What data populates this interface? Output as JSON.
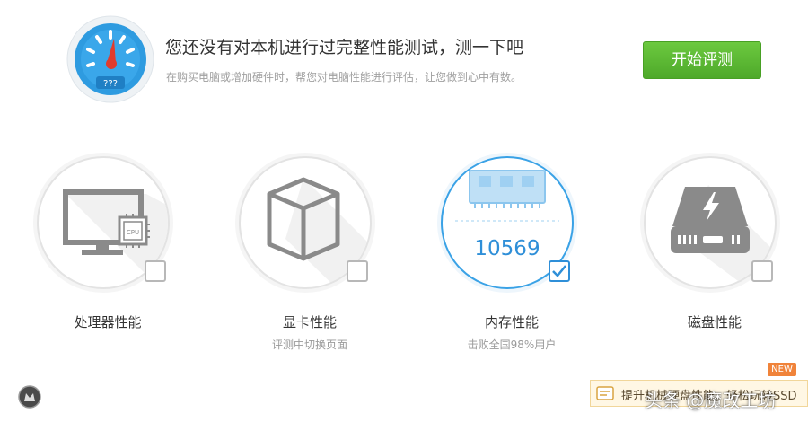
{
  "banner": {
    "headline": "您还没有对本机进行过完整性能测试，测一下吧",
    "subline": "在购买电脑或增加硬件时，帮您对电脑性能进行评估，让您做到心中有数。",
    "gauge_text": "???",
    "start_button": "开始评测"
  },
  "cards": [
    {
      "label": "处理器性能",
      "sub": "",
      "icon": "monitor-cpu-icon",
      "icon_badge": "CPU",
      "checked": false
    },
    {
      "label": "显卡性能",
      "sub": "评测中切换页面",
      "icon": "cube-icon",
      "checked": false
    },
    {
      "label": "内存性能",
      "sub": "击败全国98%用户",
      "icon": "ram-chip-icon",
      "score": "10569",
      "checked": true
    },
    {
      "label": "磁盘性能",
      "sub": "",
      "icon": "hard-drive-icon",
      "checked": false
    }
  ],
  "promo": {
    "text": "提升机械硬盘性能，轻松玩转SSD",
    "badge": "NEW"
  },
  "watermark": "头条 @魔改工坊",
  "colors": {
    "accent_blue": "#2f8fd8",
    "button_green": "#5bb832",
    "badge_orange": "#f0833a"
  }
}
